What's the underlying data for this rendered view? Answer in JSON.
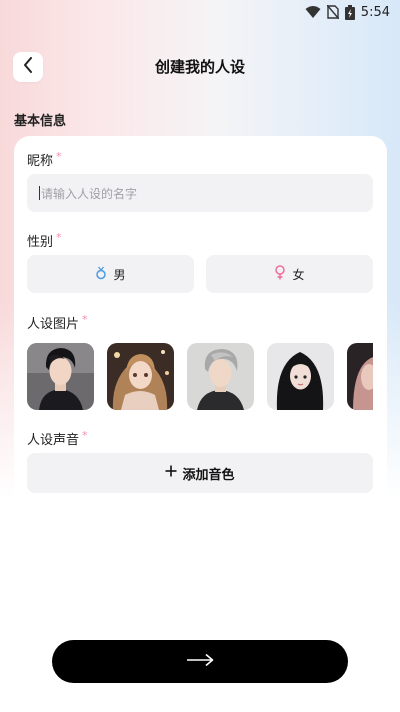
{
  "status_bar": {
    "time": "5:54"
  },
  "header": {
    "title": "创建我的人设"
  },
  "section": {
    "title": "基本信息"
  },
  "form": {
    "nickname": {
      "label": "昵称",
      "required_mark": "*",
      "placeholder": "请输入人设的名字",
      "value": ""
    },
    "gender": {
      "label": "性别",
      "required_mark": "*",
      "options": [
        {
          "label": "男",
          "icon": "male-icon",
          "color": "#4a9be0"
        },
        {
          "label": "女",
          "icon": "female-icon",
          "color": "#ee6f9a"
        }
      ]
    },
    "images": {
      "label": "人设图片",
      "required_mark": "*",
      "items": [
        {
          "name": "avatar-dark-haired-man"
        },
        {
          "name": "avatar-curly-haired-girl"
        },
        {
          "name": "avatar-silver-haired-man"
        },
        {
          "name": "avatar-black-haired-girl"
        },
        {
          "name": "avatar-partial"
        }
      ]
    },
    "voice": {
      "label": "人设声音",
      "required_mark": "*",
      "add_label": "添加音色"
    }
  },
  "next_button": {
    "icon": "arrow-right-icon"
  },
  "colors": {
    "required": "#f18fb0",
    "primary_button": "#000000",
    "field_bg": "#f2f2f4"
  }
}
